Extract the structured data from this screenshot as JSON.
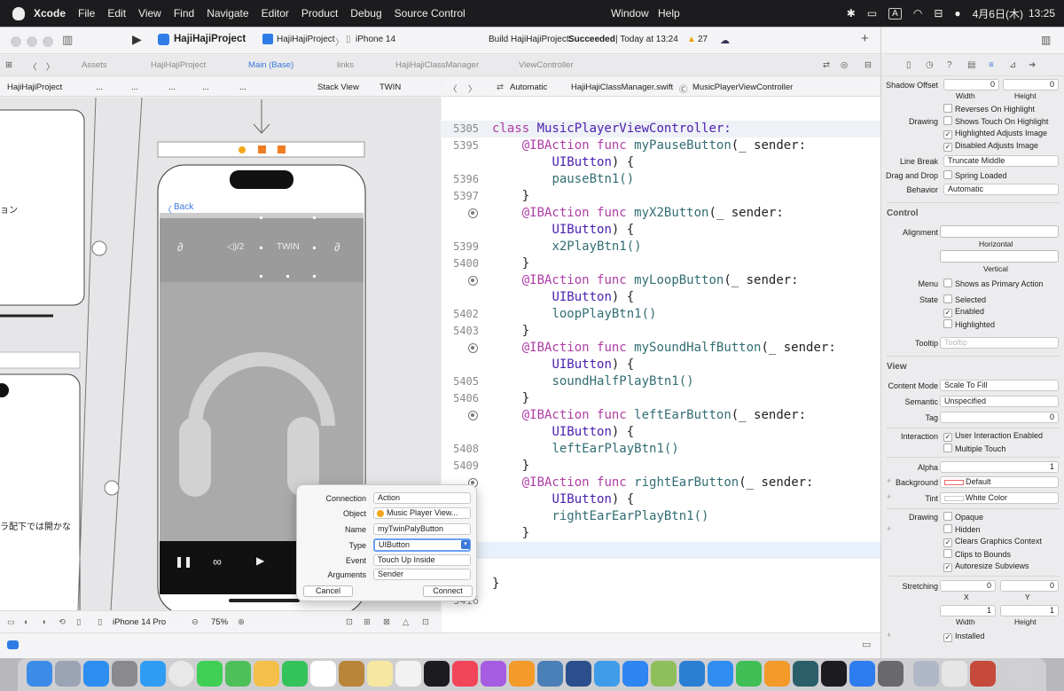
{
  "menubar": {
    "app": "Xcode",
    "items": [
      "File",
      "Edit",
      "View",
      "Find",
      "Navigate",
      "Editor",
      "Product",
      "Debug",
      "Source Control",
      "Window",
      "Help"
    ],
    "status": {
      "input_method": "A",
      "date": "4月6日(木)",
      "time": "13:25"
    }
  },
  "toolbar": {
    "project": "HajiHajiProject",
    "scheme": "HajiHajiProject",
    "device": "iPhone 14",
    "build_status_prefix": "Build HajiHajiProject:",
    "build_status_result": "Succeeded",
    "build_status_suffix": "| Today at 13:24",
    "warning_count": "27"
  },
  "tabs": [
    "Assets",
    "HajiHajiProject",
    "Main (Base)",
    "links",
    "HajiHajiClassManager",
    "ViewController"
  ],
  "jump_bar_left": [
    "HajiHajiProject",
    "...",
    "...",
    "...",
    "...",
    "...",
    "Stack View",
    "TWIN"
  ],
  "jump_bar_right": [
    "Automatic",
    "HajiHajiClassManager.swift",
    "MusicPlayerViewController"
  ],
  "canvas": {
    "jp_text_1": "ョン",
    "jp_text_2": "ラ配下では開かな",
    "back_label": "Back",
    "speed_label": "◁)/2",
    "twin_label": "TWIN",
    "device_label": "iPhone 14 Pro",
    "zoom": "75%"
  },
  "code": {
    "header": {
      "num": "5305",
      "text": "class MusicPlayerViewController:"
    },
    "actions": [
      {
        "num": "5395",
        "name": "myPauseButton",
        "body_num": "5396",
        "body": "pauseBtn1()",
        "end_num": "5397"
      },
      {
        "num": "",
        "name": "myX2Button",
        "body_num": "5399",
        "body": "x2PlayBtn1()",
        "end_num": "5400"
      },
      {
        "num": "",
        "name": "myLoopButton",
        "body_num": "5402",
        "body": "loopPlayBtn1()",
        "end_num": "5403"
      },
      {
        "num": "",
        "name": "mySoundHalfButton",
        "body_num": "5405",
        "body": "soundHalfPlayBtn1()",
        "end_num": "5406"
      },
      {
        "num": "",
        "name": "leftEarButton",
        "body_num": "5408",
        "body": "leftEarPlayBtn1()",
        "end_num": "5409"
      },
      {
        "num": "",
        "name": "rightEarButton",
        "body_num": "",
        "body": "rightEarEarPlayBtn1()",
        "end_num": ""
      }
    ],
    "kw_ibaction": "@IBAction",
    "kw_func": "func",
    "param": "(_ sender:",
    "param_type": "UIButton",
    "brace_open": ") {",
    "brace_close": "}",
    "last_line_num": "5416"
  },
  "popover": {
    "connection_label": "Connection",
    "connection_value": "Action",
    "object_label": "Object",
    "object_value": "Music Player View...",
    "name_label": "Name",
    "name_value": "myTwinPalyButton",
    "type_label": "Type",
    "type_value": "UIButton",
    "event_label": "Event",
    "event_value": "Touch Up Inside",
    "arguments_label": "Arguments",
    "arguments_value": "Sender",
    "cancel": "Cancel",
    "connect": "Connect"
  },
  "inspector": {
    "shadow_offset": "Shadow Offset",
    "so_x": "0",
    "so_y": "0",
    "width": "Width",
    "height": "Height",
    "reverses_on_highlight": "Reverses On Highlight",
    "drawing": "Drawing",
    "shows_touch": "Shows Touch On Highlight",
    "highlighted_adjusts": "Highlighted Adjusts Image",
    "disabled_adjusts": "Disabled Adjusts Image",
    "line_break_label": "Line Break",
    "line_break": "Truncate Middle",
    "drag_drop_label": "Drag and Drop",
    "drag_drop": "Spring Loaded",
    "behavior_label": "Behavior",
    "behavior": "Automatic",
    "control": "Control",
    "alignment": "Alignment",
    "horizontal": "Horizontal",
    "vertical": "Vertical",
    "menu_label": "Menu",
    "menu": "Shows as Primary Action",
    "state_label": "State",
    "selected": "Selected",
    "enabled": "Enabled",
    "highlighted": "Highlighted",
    "tooltip_label": "Tooltip",
    "tooltip_placeholder": "Tooltip",
    "view": "View",
    "content_mode_label": "Content Mode",
    "content_mode": "Scale To Fill",
    "semantic_label": "Semantic",
    "semantic": "Unspecified",
    "tag_label": "Tag",
    "tag": "0",
    "interaction_label": "Interaction",
    "user_interaction": "User Interaction Enabled",
    "multiple_touch": "Multiple Touch",
    "alpha_label": "Alpha",
    "alpha": "1",
    "background_label": "Background",
    "background": "Default",
    "tint_label": "Tint",
    "tint": "White Color",
    "drawing2": "Drawing",
    "opaque": "Opaque",
    "hidden": "Hidden",
    "clears": "Clears Graphics Context",
    "clips": "Clips to Bounds",
    "autoresize": "Autoresize Subviews",
    "stretching_label": "Stretching",
    "st_x": "0",
    "st_y": "0",
    "x": "X",
    "y": "Y",
    "st_w": "1",
    "st_h": "1",
    "installed": "Installed"
  }
}
